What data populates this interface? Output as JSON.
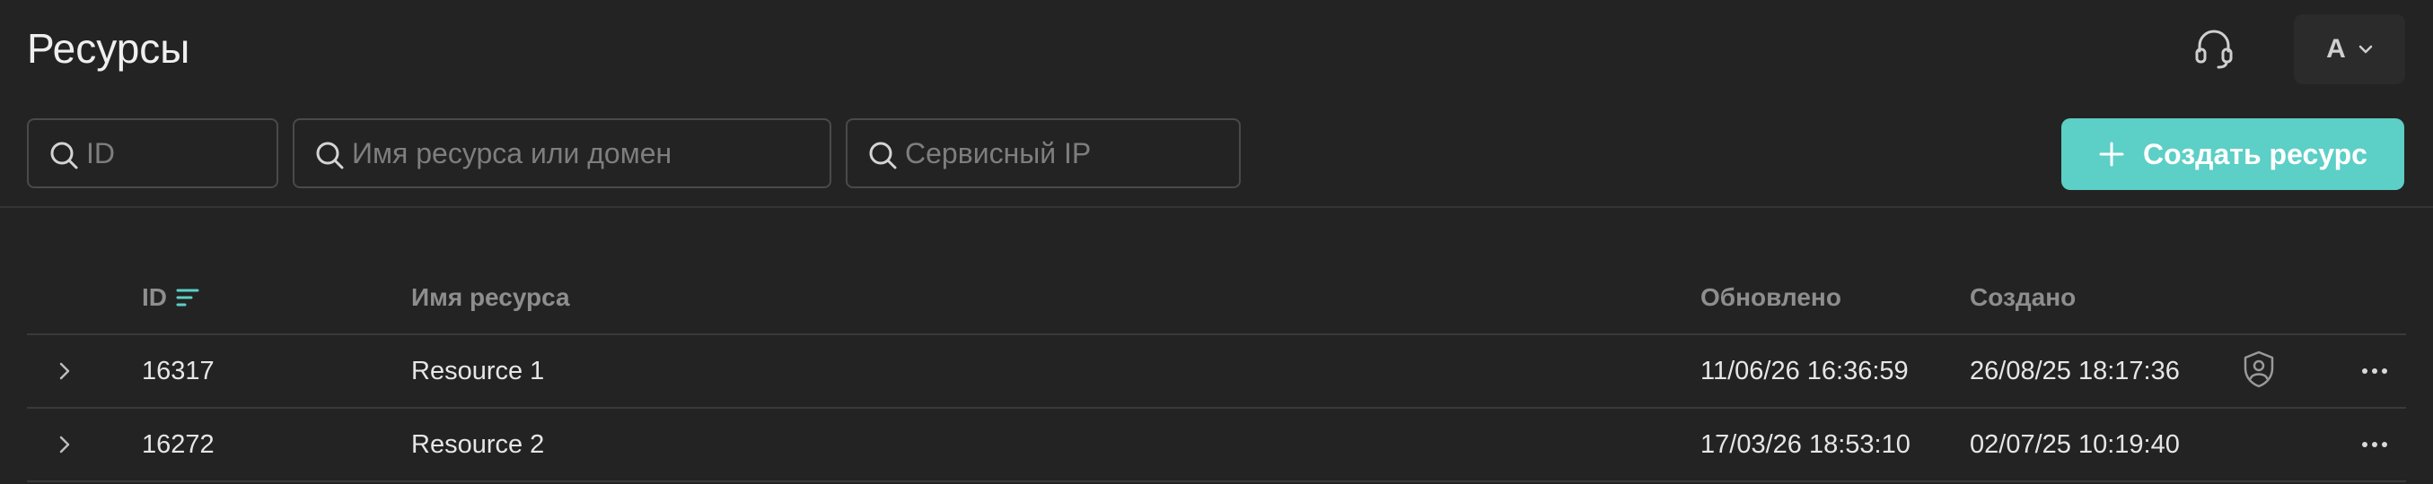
{
  "header": {
    "title": "Ресурсы",
    "support_icon": "headset-icon",
    "user_initial": "A"
  },
  "filters": {
    "id_placeholder": "ID",
    "name_placeholder": "Имя ресурса или домен",
    "ip_placeholder": "Сервисный IP",
    "create_label": "Создать ресурс"
  },
  "colors": {
    "background": "#232323",
    "accent": "#5ccfc6",
    "muted_text": "#8e8e8e",
    "border": "#4a4a4a"
  },
  "table": {
    "columns": {
      "id": "ID",
      "name": "Имя ресурса",
      "updated": "Обновлено",
      "created": "Создано"
    },
    "sort_icon": "sort-icon",
    "rows": [
      {
        "id": "16317",
        "name": "Resource 1",
        "updated": "11/06/26 16:36:59",
        "created": "26/08/25 18:17:36",
        "protected": true
      },
      {
        "id": "16272",
        "name": "Resource 2",
        "updated": "17/03/26 18:53:10",
        "created": "02/07/25 10:19:40",
        "protected": false
      }
    ]
  }
}
